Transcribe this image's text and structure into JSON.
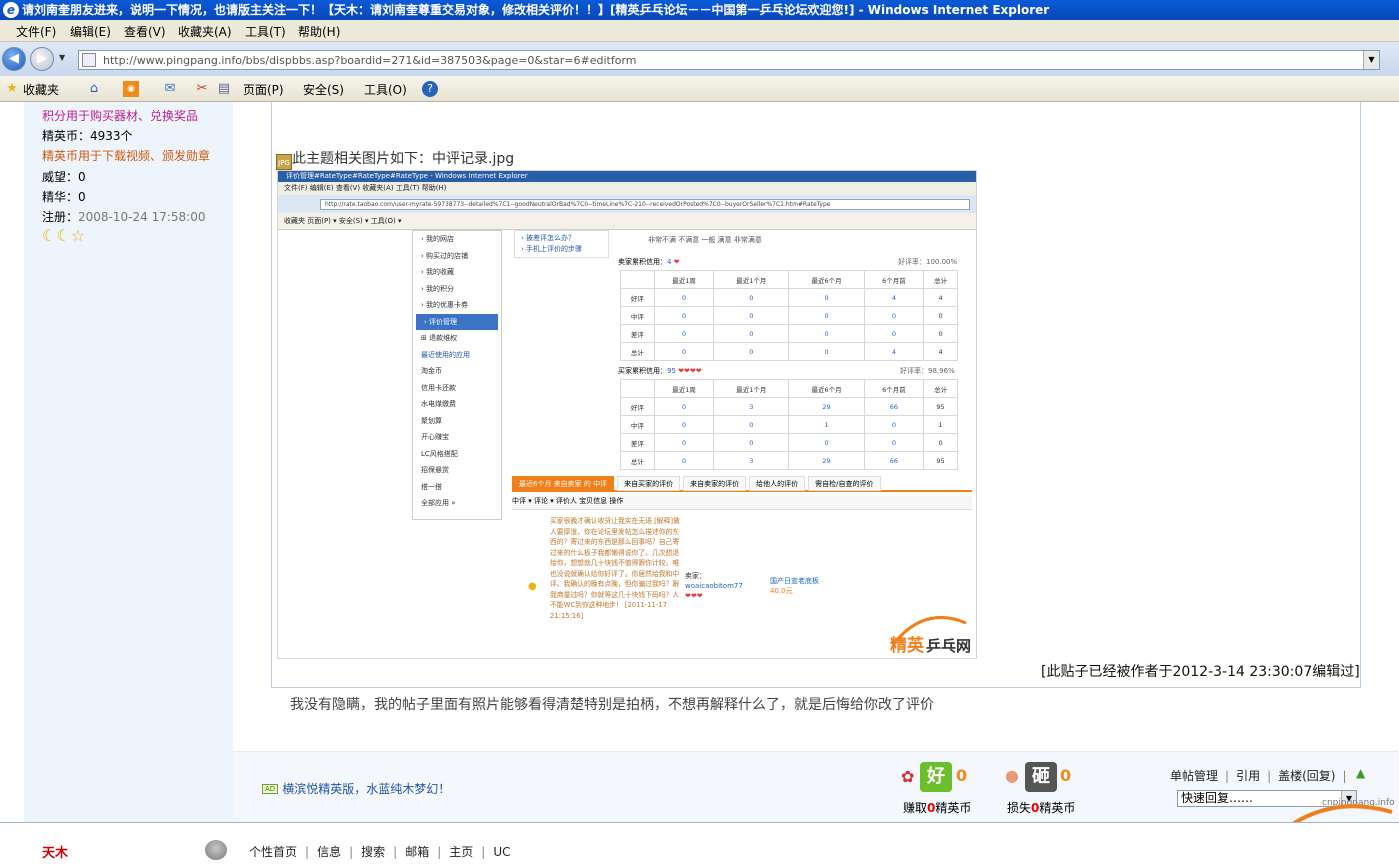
{
  "window": {
    "title": "请刘南奎朋友进来，说明一下情况，也请版主关注一下！【天木：请刘南奎尊重交易对象，修改相关评价！！】[精英乒乓论坛－－中国第一乒乓论坛欢迎您!] - Windows Internet Explorer"
  },
  "menu": [
    "文件(F)",
    "编辑(E)",
    "查看(V)",
    "收藏夹(A)",
    "工具(T)",
    "帮助(H)"
  ],
  "address": {
    "url": "http://www.pingpang.info/bbs/dispbbs.asp?boardid=271&id=387503&page=0&star=6#editform"
  },
  "toolbar": {
    "favorites": "收藏夹",
    "page": "页面(P)",
    "safety": "安全(S)",
    "tools": "工具(O)"
  },
  "sidebar": {
    "points_note": "积分用于购买器材、兑换奖品",
    "coins": "精英币：4933个",
    "coins_note": "精英币用于下载视频、颁发勋章",
    "prestige": "威望：0",
    "essence": "精华：0",
    "register_label": "注册：",
    "register_date": "2008-10-24 17:58:00"
  },
  "post": {
    "image_caption": "此主题相关图片如下：中评记录.jpg",
    "edit_note": "[此贴子已经被作者于2012-3-14 23:30:07编辑过]",
    "body": "我没有隐瞒，我的帖子里面有照片能够看得清楚特别是拍柄，不想再解释什么了，就是后悔给你改了评价"
  },
  "screenshot": {
    "title": "评价管理#RateType#RateType#RateType - Windows Internet Explorer",
    "menu": "文件(F)  编辑(E)  查看(V)  收藏夹(A)  工具(T)  帮助(H)",
    "url": "http://rate.taobao.com/user-myrate-59738773--detailed%7C1--goodNeutralOrBad%7C0--timeLine%7C-210--receivedOrPosted%7C0--buyerOrSeller%7C1.htm#RateType",
    "favbar": "收藏夹        页面(P) ▾  安全(S) ▾  工具(O) ▾",
    "side_items": [
      "› 我的网店",
      "› 购买过的店铺",
      "› 我的收藏",
      "› 我的积分",
      "› 我的优惠卡券",
      "› 评价管理",
      "⊞ 退款维权",
      "最近使用的应用",
      "淘金币",
      "信用卡还款",
      "水电煤缴费",
      "聚划算",
      "开心赚宝",
      "LC风格搭配",
      "招保悬赏",
      "搭一搭",
      "全部应用 »"
    ],
    "help_links": [
      "› 被差评怎么办？",
      "› 手机上评价的步骤"
    ],
    "rating_header": "非常不满    不满意    一般    满意    非常满意",
    "seller_credit": "卖家累积信用：",
    "seller_score": "4",
    "seller_rate": "好评率：100.00%",
    "buyer_credit": "买家累积信用：",
    "buyer_score": "95",
    "buyer_rate": "好评率：98.96%",
    "table_cols": [
      "",
      "最近1周",
      "最近1个月",
      "最近6个月",
      "6个月前",
      "总计"
    ],
    "seller_rows": [
      [
        "好评",
        "0",
        "0",
        "0",
        "4",
        "4"
      ],
      [
        "中评",
        "0",
        "0",
        "0",
        "0",
        "0"
      ],
      [
        "差评",
        "0",
        "0",
        "0",
        "0",
        "0"
      ],
      [
        "总计",
        "0",
        "0",
        "0",
        "4",
        "4"
      ]
    ],
    "buyer_rows": [
      [
        "好评",
        "0",
        "3",
        "29",
        "66",
        "95"
      ],
      [
        "中评",
        "0",
        "0",
        "1",
        "0",
        "1"
      ],
      [
        "差评",
        "0",
        "0",
        "0",
        "0",
        "0"
      ],
      [
        "总计",
        "0",
        "3",
        "29",
        "66",
        "95"
      ]
    ],
    "tabs": [
      "最近6个月 来自卖家 的 中评",
      "来自买家的评价",
      "来自卖家的评价",
      "给他人的评价",
      "需自检/自查的评价"
    ],
    "list_header": "中评 ▾     评论 ▾                              评价人                 宝贝信息                                                                     操作",
    "comment": "买家很晚才确认收货让我实在无语 [解释]做人要厚道，你在论坛里发帖怎么描述你的东西的？寄过来的东西是那么回事吗？自己寄过来的什么板子我都懒得说你了。几次想退给你，想想就几十块钱不值得跟你计较，唯也没说就确认给你好评了。你居然给我和中评。我确认的晚有点晚，但你骗过我吗？跟我商量过吗？你就等这几十块钱下码吗？人不能WC到你这种地步！ [2011-11-17 21:15:16]",
    "seller": "卖家：",
    "seller_name": "woaicaobitom77",
    "item": "国产日宣老底板",
    "price": "40.0元",
    "watermark": "cnpingpang.info 精英乒乓网"
  },
  "footer": {
    "ad_badge": "AD",
    "ad_text": "横滨悦精英版，水蓝纯木梦幻！",
    "good_face": "好",
    "good_count": "0",
    "good_label_a": "赚取",
    "good_label_n": "0",
    "good_label_b": "精英币",
    "bad_face": "砸",
    "bad_count": "0",
    "bad_label_a": "损失",
    "bad_label_n": "0",
    "bad_label_b": "精英币",
    "links": [
      "单帖管理",
      "引用",
      "盖楼(回复)"
    ],
    "quick_reply": "快速回复……",
    "watermark_url": "cnpingpang.info",
    "watermark_logo": "精英乒乓网"
  },
  "author": {
    "name": "天木",
    "links": [
      "个性首页",
      "信息",
      "搜索",
      "邮箱",
      "主页",
      "UC"
    ]
  },
  "colors": {
    "titlebar": "#0a5bd8",
    "sidebar_bg": "#eef4fc",
    "link_blue": "#2255aa",
    "accent_orange": "#f07f1a",
    "author_red": "#cc0000"
  }
}
